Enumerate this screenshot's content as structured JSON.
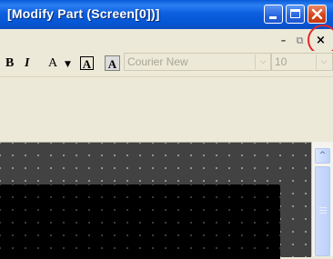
{
  "window": {
    "title": "[Modify Part (Screen[0])]",
    "minimize_icon": "minimize-icon",
    "maximize_icon": "maximize-icon",
    "close_icon": "close-icon"
  },
  "mdi_controls": {
    "minimize_label": "–",
    "restore_label": "⧉",
    "close_label": "×",
    "highlight_color": "#e0282d"
  },
  "toolbar": {
    "bold_label": "B",
    "italic_label": "I",
    "font_color_label": "A",
    "font_color_dropdown": "▼",
    "highlight_label": "A",
    "background_label": "A",
    "font_name": "Courier New",
    "font_size": "10",
    "dropdown_arrow": "⌵"
  },
  "scrollbar": {
    "up_arrow": "^"
  },
  "colors": {
    "title_bar": "#0a5bd8",
    "workspace": "#424242",
    "canvas": "#000000",
    "chrome": "#ece9d8"
  }
}
